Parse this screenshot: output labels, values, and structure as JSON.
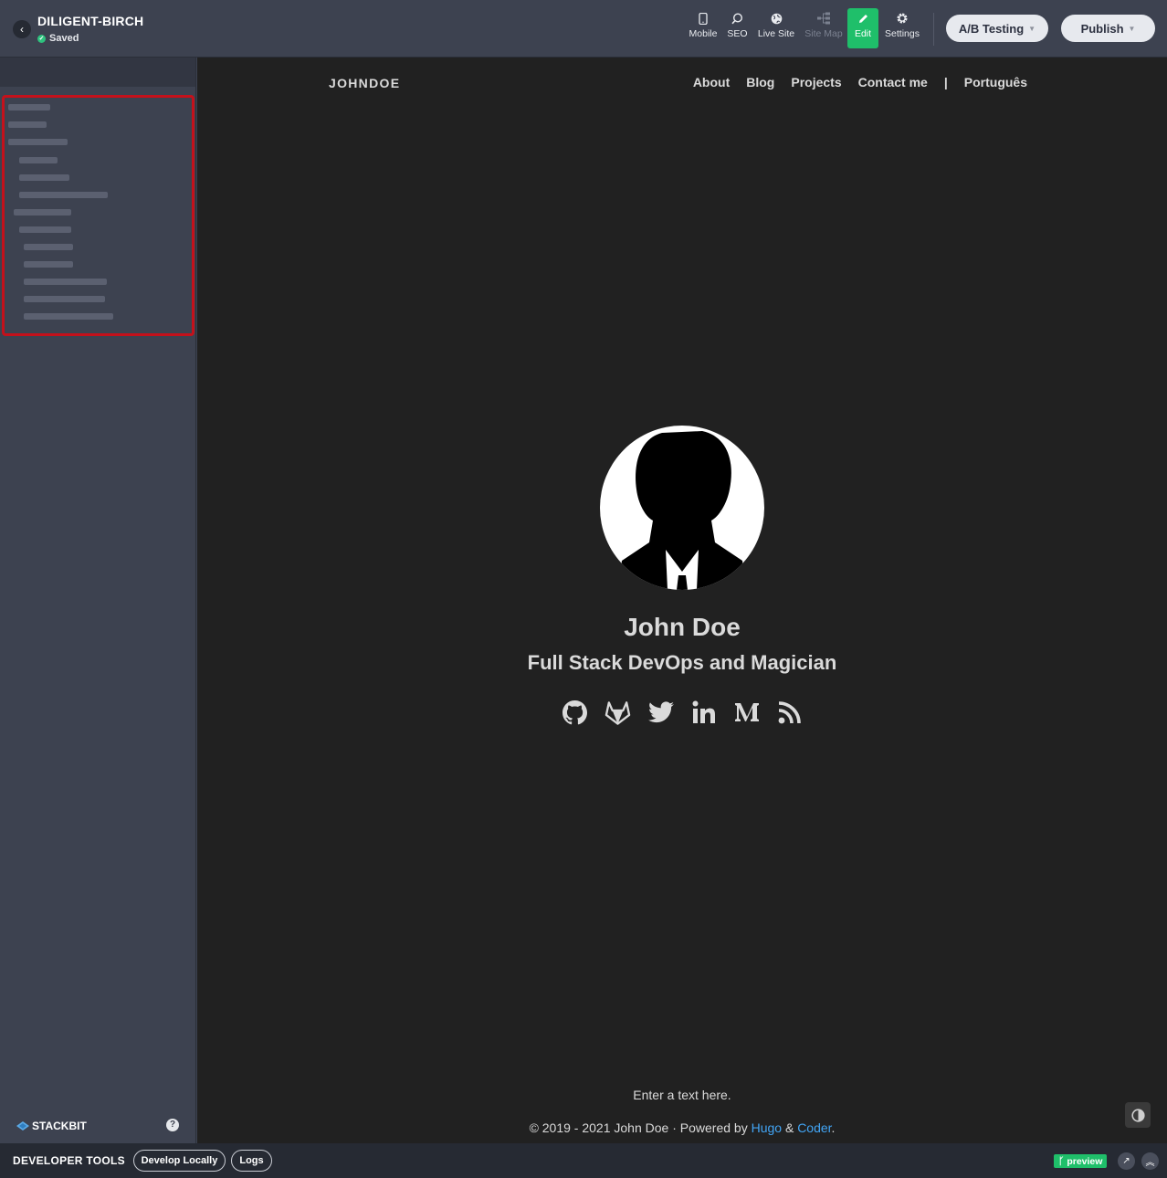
{
  "topbar": {
    "project_name": "DILIGENT-BIRCH",
    "save_status": "Saved",
    "tools": [
      {
        "label": "Mobile",
        "icon": "mobile-icon"
      },
      {
        "label": "SEO",
        "icon": "seo-search-icon"
      },
      {
        "label": "Live Site",
        "icon": "globe-icon"
      },
      {
        "label": "Site Map",
        "icon": "sitemap-icon",
        "disabled": true
      },
      {
        "label": "Edit",
        "icon": "pencil-icon",
        "active": true
      },
      {
        "label": "Settings",
        "icon": "gear-icon"
      }
    ],
    "ab_testing_label": "A/B Testing",
    "publish_label": "Publish"
  },
  "sidebar": {
    "brand": "STACKBIT",
    "help": "?"
  },
  "site": {
    "logo": "JOHNDOE",
    "nav": [
      "About",
      "Blog",
      "Projects",
      "Contact me",
      "|",
      "Português"
    ],
    "name": "John Doe",
    "tagline": "Full Stack DevOps and Magician",
    "social_icons": [
      "github-icon",
      "gitlab-icon",
      "twitter-icon",
      "linkedin-icon",
      "medium-icon",
      "rss-icon"
    ],
    "footer_text": "Enter a text here.",
    "copyright_prefix": "© 2019 - 2021 John Doe · Powered by ",
    "hugo_link": "Hugo",
    "amp": " & ",
    "coder_link": "Coder",
    "period": "."
  },
  "devbar": {
    "title": "DEVELOPER TOOLS",
    "develop_locally": "Develop Locally",
    "logs": "Logs",
    "branch": "preview"
  },
  "colors": {
    "accent_green": "#1fbf6a",
    "link_blue": "#42a5f5",
    "highlight_red": "#c4111b"
  }
}
